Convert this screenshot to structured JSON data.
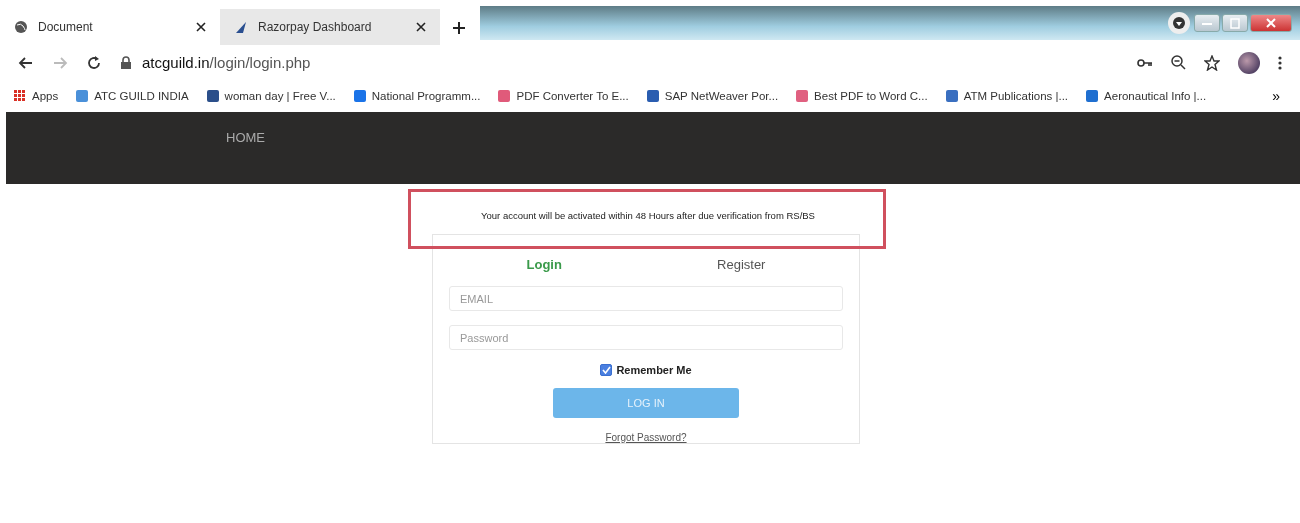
{
  "browser": {
    "tabs": [
      {
        "title": "Document",
        "selected": true
      },
      {
        "title": "Razorpay Dashboard",
        "selected": false
      }
    ],
    "address": {
      "domain": "atcguild.in",
      "path": "/login/login.php"
    },
    "bookmarks": [
      {
        "label": "Apps",
        "color": "#d93025"
      },
      {
        "label": "ATC GUILD INDIA",
        "color": "#4a90d9"
      },
      {
        "label": "woman day | Free V...",
        "color": "#2b4f8a"
      },
      {
        "label": "National Programm...",
        "color": "#1a73e8"
      },
      {
        "label": "PDF Converter To E...",
        "color": "#e05a7a"
      },
      {
        "label": "SAP NetWeaver Por...",
        "color": "#2a5db0"
      },
      {
        "label": "Best PDF to Word C...",
        "color": "#e06080"
      },
      {
        "label": "ATM Publications |...",
        "color": "#3a6fc0"
      },
      {
        "label": "Aeronautical Info |...",
        "color": "#1f6fd0"
      }
    ],
    "overflow": "»"
  },
  "nav": {
    "items": [
      "HOME"
    ]
  },
  "notice": "Your account will be activated within 48 Hours after due verification from RS/BS",
  "login": {
    "tabs": [
      {
        "label": "Login",
        "selected": true
      },
      {
        "label": "Register",
        "selected": false
      }
    ],
    "fields": [
      {
        "placeholder": "EMAIL"
      },
      {
        "placeholder": "Password"
      }
    ],
    "remember": {
      "label": "Remember Me",
      "checked": true
    },
    "submit": "LOG IN",
    "forgot": "Forgot Password?"
  }
}
